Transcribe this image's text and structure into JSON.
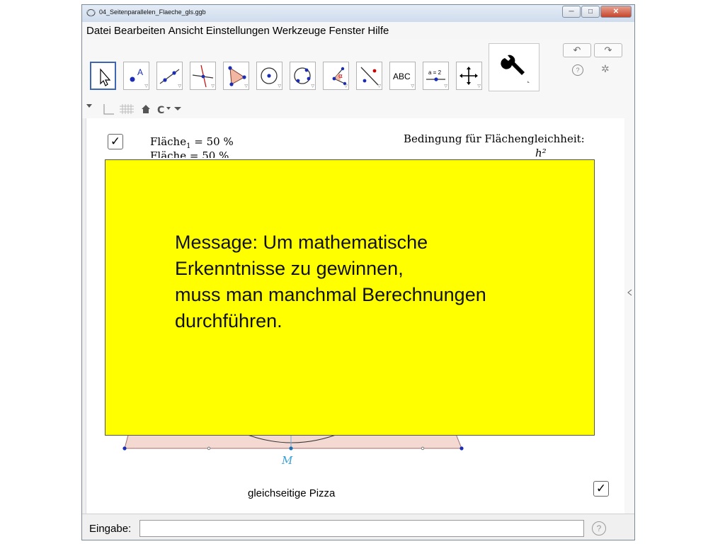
{
  "window": {
    "title": "04_Seitenparallelen_Flaeche_gls.ggb",
    "minimize_label": "─",
    "maximize_label": "□",
    "close_label": "✕"
  },
  "menu": [
    "Datei",
    "Bearbeiten",
    "Ansicht",
    "Einstellungen",
    "Werkzeuge",
    "Fenster",
    "Hilfe"
  ],
  "toolbar": {
    "tools": [
      {
        "name": "move-tool",
        "icon": "arrow-pointer-icon"
      },
      {
        "name": "point-tool",
        "icon": "point-icon",
        "text": "A"
      },
      {
        "name": "line-tool",
        "icon": "line-icon"
      },
      {
        "name": "perpendicular-tool",
        "icon": "perpendicular-line-icon"
      },
      {
        "name": "polygon-tool",
        "icon": "polygon-icon"
      },
      {
        "name": "circle-tool",
        "icon": "circle-center-point-icon"
      },
      {
        "name": "circle-three-points-tool",
        "icon": "circle-three-points-icon"
      },
      {
        "name": "angle-tool",
        "icon": "angle-icon",
        "text": "α"
      },
      {
        "name": "reflect-tool",
        "icon": "reflect-line-icon"
      },
      {
        "name": "text-tool",
        "icon": "text-abc-icon",
        "text": "ABC"
      },
      {
        "name": "slider-tool",
        "icon": "slider-icon",
        "text": "a = 2"
      },
      {
        "name": "move-graphics-tool",
        "icon": "move-arrows-icon"
      }
    ],
    "undo_label": "↶",
    "redo_label": "↷",
    "help_label": "?",
    "settings_icon": "gear-icon"
  },
  "canvas": {
    "area1_label": "Fläche",
    "area1_sub": "1",
    "area1_value": "= 50 %",
    "area2_label": "Fläche",
    "area2_value": "= 50 %",
    "condition_label": "Bedingung für Flächengleichheit:",
    "formula_fragment": "h²",
    "point_label": "M",
    "pizza_label": "gleichseitige Pizza"
  },
  "message": {
    "text": "Message: Um mathematische\nErkenntnisse zu gewinnen,\nmuss man manchmal Berechnungen\ndurchführen."
  },
  "input_bar": {
    "label": "Eingabe:",
    "value": "",
    "help": "?"
  },
  "colors": {
    "message_background": "#ffff00",
    "accent": "#3d66b3",
    "shape_fill": "#f4d8d2",
    "point_color": "#1a2db4"
  }
}
